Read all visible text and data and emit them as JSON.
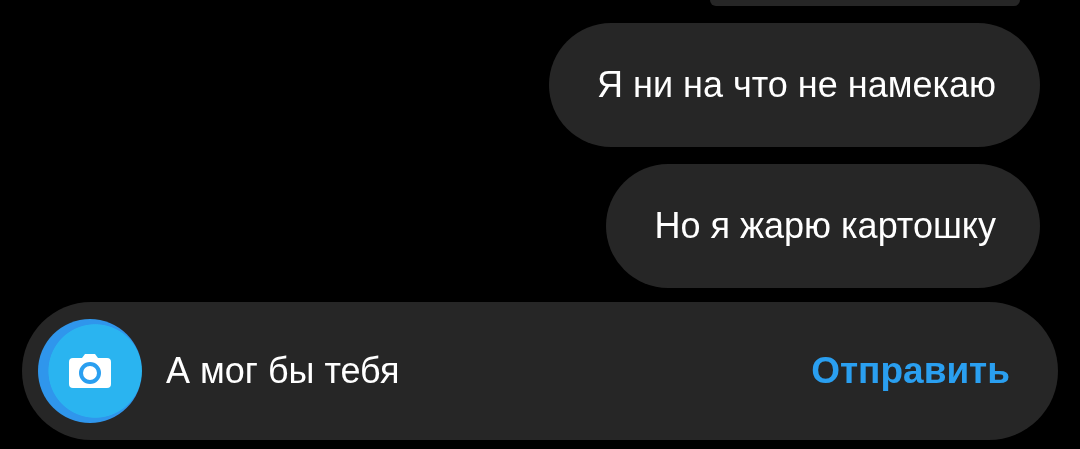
{
  "messages": [
    {
      "text": "Я ни на что не намекаю"
    },
    {
      "text": "Но я жарю картошку"
    }
  ],
  "composer": {
    "value": "А мог бы тебя",
    "send_label": "Отправить"
  }
}
